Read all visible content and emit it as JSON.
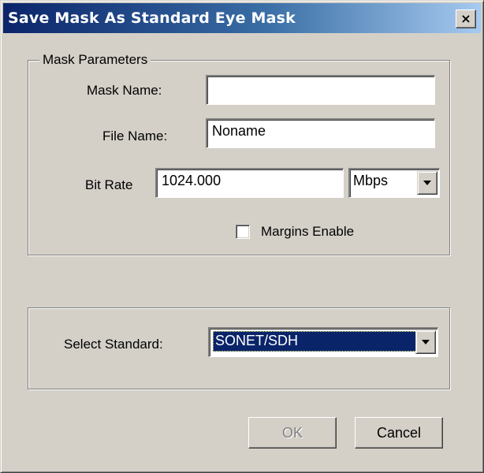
{
  "window": {
    "title": "Save Mask As Standard Eye Mask",
    "close_label": "×"
  },
  "mask_parameters": {
    "legend": "Mask Parameters",
    "mask_name_label": "Mask Name:",
    "mask_name_value": "",
    "file_name_label": "File Name:",
    "file_name_value": "Noname",
    "bit_rate_label": "Bit Rate",
    "bit_rate_value": "1024.000",
    "bit_rate_unit": "Mbps",
    "margins_label": "Margins Enable",
    "margins_checked": false
  },
  "standard": {
    "label": "Select Standard:",
    "selected": "SONET/SDH"
  },
  "buttons": {
    "ok": "OK",
    "cancel": "Cancel"
  },
  "icons": {
    "dropdown": "chevron-down-icon",
    "close": "close-icon"
  }
}
